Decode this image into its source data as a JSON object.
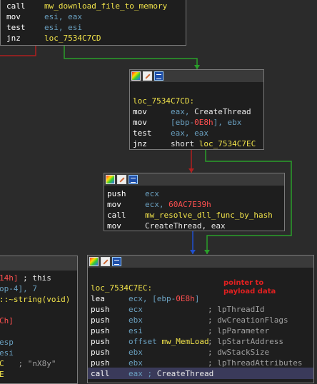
{
  "block1": {
    "lines": [
      {
        "mn": "call",
        "op": "mw_download_file_to_memory",
        "cls": "func"
      },
      {
        "mn": "mov",
        "op": "esi, eax",
        "cls": "reg"
      },
      {
        "mn": "test",
        "op": "esi, esi",
        "cls": "reg"
      },
      {
        "mn": "jnz",
        "op": "loc_7534C7CD",
        "cls": "func"
      }
    ]
  },
  "block2": {
    "label": "loc_7534C7CD:",
    "lines": [
      {
        "mn": "mov",
        "op1": "eax, ",
        "op2": "CreateThread"
      },
      {
        "mn": "mov",
        "op1": "[ebp-",
        "op2": "0E8h",
        "op3": "], ebx"
      },
      {
        "mn": "test",
        "op1": "eax, eax"
      },
      {
        "mn": "jnz",
        "op1": "short ",
        "op2": "loc_7534C7EC"
      }
    ]
  },
  "block3": {
    "lines": [
      {
        "mn": "push",
        "op1": "ecx"
      },
      {
        "mn": "mov",
        "op1": "ecx, ",
        "op2": "60AC7E39h"
      },
      {
        "mn": "call",
        "op1": "mw_resolve_dll_func_by_hash"
      },
      {
        "mn": "mov",
        "op1": "CreateThread, eax"
      }
    ]
  },
  "block4": {
    "lines": [
      {
        "a": "14h]",
        "b": " ; this"
      },
      {
        "a": "op-4], 7"
      },
      {
        "a": "::~string(void)"
      },
      {
        "a": "Ch]"
      },
      {
        "a": "esp"
      },
      {
        "a": "esi"
      },
      {
        "a": "C",
        "b": "   ; \"nX8y\""
      },
      {
        "a": "E"
      }
    ]
  },
  "block5": {
    "label": "loc_7534C7EC:",
    "lines": [
      {
        "mn": "lea",
        "op1": "ecx, [ebp-",
        "op2": "0E8h",
        "op3": "]",
        "cmt": ""
      },
      {
        "mn": "push",
        "op1": "ecx",
        "cmt": "; lpThreadId"
      },
      {
        "mn": "push",
        "op1": "ebx",
        "cmt": "; dwCreationFlags"
      },
      {
        "mn": "push",
        "op1": "esi",
        "cmt": "; lpParameter"
      },
      {
        "mn": "push",
        "op1": "offset ",
        "op2": "mw_MemLoad",
        "cmt": "; lpStartAddress"
      },
      {
        "mn": "push",
        "op1": "ebx",
        "cmt": "; dwStackSize"
      },
      {
        "mn": "push",
        "op1": "ebx",
        "cmt": "; lpThreadAttributes"
      },
      {
        "mn": "call",
        "op1": "eax ; ",
        "op2": "CreateThread",
        "cmt": ""
      }
    ]
  },
  "annotation": {
    "line1": "pointer to",
    "line2": "payload data"
  },
  "colors": {
    "edge_true": "#2aa02a",
    "edge_false": "#b02020",
    "edge_uncond": "#2050d0"
  }
}
